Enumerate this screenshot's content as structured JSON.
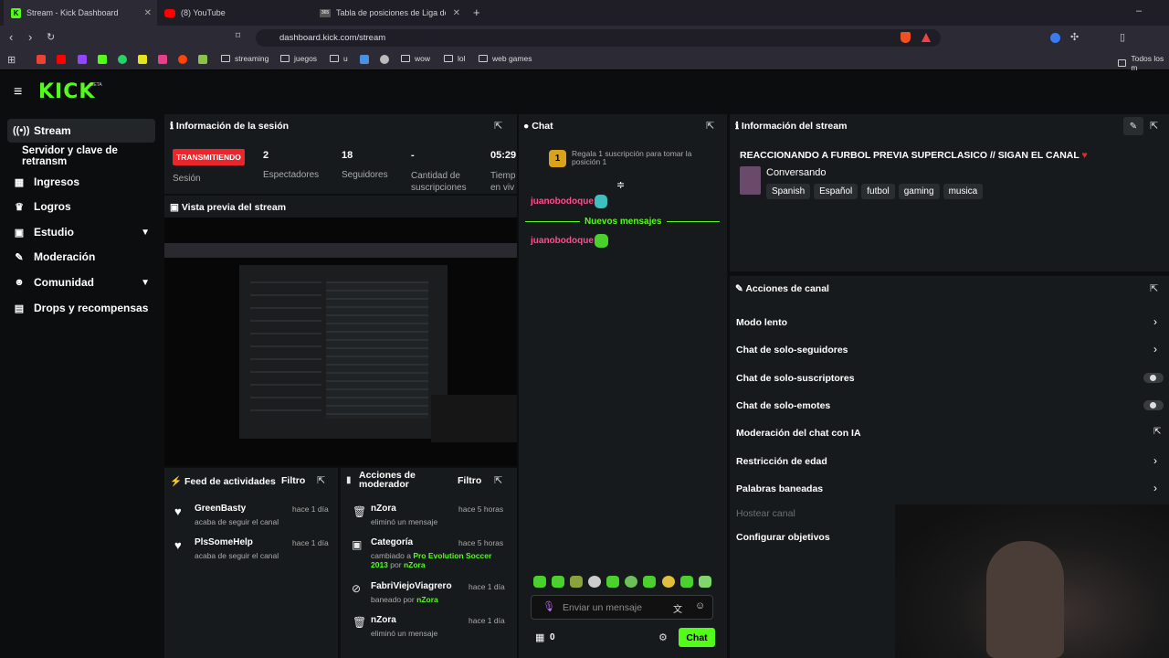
{
  "browser": {
    "tabs": [
      {
        "label": "Stream - Kick Dashboard"
      },
      {
        "label": "(8) YouTube"
      },
      {
        "label": "Tabla de posiciones de Liga de P"
      }
    ],
    "url": "dashboard.kick.com/stream",
    "bookmarks": [
      "streaming",
      "juegos",
      "u",
      "wow",
      "lol",
      "web games",
      "Todos los m"
    ]
  },
  "brand": {
    "logo": "KICK",
    "beta": "BETA",
    "accent": "#53fc18"
  },
  "sidebar": {
    "items": [
      {
        "label": "Stream",
        "icon": "broadcast-icon"
      },
      {
        "label": "Servidor y clave de retransm"
      },
      {
        "label": "Ingresos",
        "icon": "chart-icon"
      },
      {
        "label": "Logros",
        "icon": "trophy-icon"
      },
      {
        "label": "Estudio",
        "icon": "studio-icon"
      },
      {
        "label": "Moderación",
        "icon": "wrench-icon"
      },
      {
        "label": "Comunidad",
        "icon": "community-icon"
      },
      {
        "label": "Drops y recompensas",
        "icon": "drops-icon"
      }
    ]
  },
  "session": {
    "title": "Información de la sesión",
    "live_badge": "TRANSMITIENDO",
    "live_label": "Sesión",
    "stats": [
      {
        "value": "2",
        "label": "Espectadores"
      },
      {
        "value": "18",
        "label": "Seguidores"
      },
      {
        "value": "-",
        "label": "Cantidad de suscripciones"
      },
      {
        "value": "05:29",
        "label": "Tiemp en viv"
      }
    ]
  },
  "preview": {
    "title": "Vista previa del stream"
  },
  "feed": {
    "title": "Feed de actividades",
    "filter": "Filtro",
    "items": [
      {
        "name": "GreenBasty",
        "sub": "acaba de seguir el canal",
        "time": "hace 1 día"
      },
      {
        "name": "PlsSomeHelp",
        "sub": "acaba de seguir el canal",
        "time": "hace 1 día"
      }
    ]
  },
  "modactions": {
    "title": "Acciones de moderador",
    "filter": "Filtro",
    "items": [
      {
        "name": "nZora",
        "sub": "eliminó un mensaje",
        "time": "hace 5 horas"
      },
      {
        "name": "Categoría",
        "sub": "cambiado a",
        "sub_hl": "Pro Evolution Soccer 2013",
        "sub_by": "por",
        "sub_user": "nZora",
        "time": "hace 5 horas"
      },
      {
        "name": "FabriViejoViagrero",
        "sub": "baneado por",
        "sub_user": "nZora",
        "time": "hace 1 día"
      },
      {
        "name": "nZora",
        "sub": "eliminó un mensaje",
        "time": "hace 1 día"
      }
    ]
  },
  "chat": {
    "title": "Chat",
    "gift_rank": "1",
    "gift_text": "Regala 1 suscripción para tomar la posición 1",
    "messages": [
      {
        "user": "juanobodoque"
      },
      {
        "user": "juanobodoque"
      }
    ],
    "new_messages": "Nuevos mensajes",
    "placeholder": "Enviar un mensaje",
    "count": "0",
    "send": "Chat"
  },
  "streaminfo": {
    "title": "Información del stream",
    "stream_title": "REACCIONANDO A FURBOL PREVIA SUPERCLASICO // SIGAN EL CANAL",
    "category": "Conversando",
    "tags": [
      "Spanish",
      "Español",
      "futbol",
      "gaming",
      "musica"
    ]
  },
  "channel_actions": {
    "title": "Acciones de canal",
    "items": [
      {
        "label": "Modo lento",
        "control": "chevron"
      },
      {
        "label": "Chat de solo-seguidores",
        "control": "chevron"
      },
      {
        "label": "Chat de solo-suscriptores",
        "control": "toggle"
      },
      {
        "label": "Chat de solo-emotes",
        "control": "toggle"
      },
      {
        "label": "Moderación del chat con IA",
        "control": "external"
      },
      {
        "label": "Restricción de edad",
        "control": "chevron"
      },
      {
        "label": "Palabras baneadas",
        "control": "chevron"
      },
      {
        "label": "Hostear canal",
        "control": "none"
      },
      {
        "label": "Configurar objetivos",
        "control": "none"
      }
    ]
  }
}
